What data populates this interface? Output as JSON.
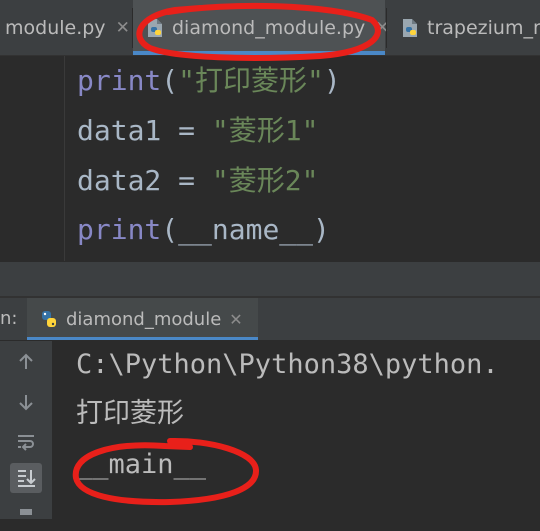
{
  "editor_tabs": [
    {
      "label": "module.py",
      "active": false
    },
    {
      "label": "diamond_module.py",
      "active": true
    },
    {
      "label": "trapezium_m",
      "active": false
    }
  ],
  "editor": {
    "line1": {
      "fn": "print",
      "open": "(",
      "str": "\"打印菱形\"",
      "close": ")"
    },
    "line2": {
      "var": "data1 = ",
      "str": "\"菱形1\""
    },
    "line3": {
      "var": "data2 = ",
      "str": "\"菱形2\""
    },
    "line4": {
      "fn": "print",
      "rest": "(__name__)"
    }
  },
  "run_panel": {
    "label": "n:",
    "tab_label": "diamond_module"
  },
  "console": {
    "lines": [
      "C:\\Python\\Python38\\python.",
      "打印菱形",
      "__main__"
    ]
  },
  "icons": {
    "python": "python-file-icon",
    "close": "close-icon"
  },
  "colors": {
    "annotation": "#e8201a",
    "tab_underline": "#4a88c7"
  }
}
